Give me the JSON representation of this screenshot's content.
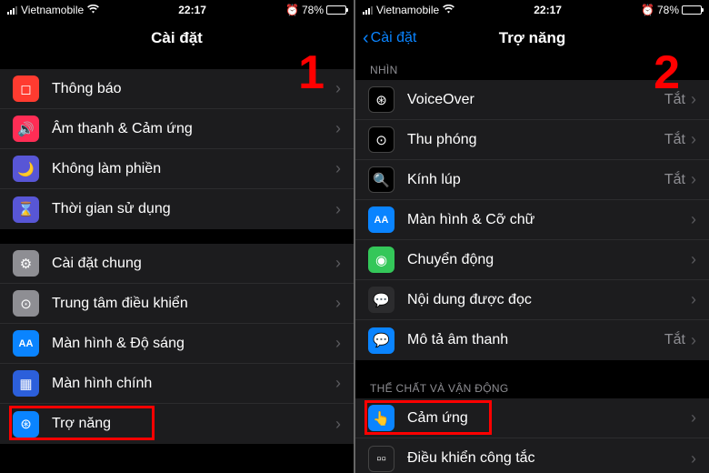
{
  "status": {
    "carrier": "Vietnamobile",
    "time": "22:17",
    "battery_pct": "78%",
    "alarm": "⏰"
  },
  "left": {
    "title": "Cài đặt",
    "step_number": "1",
    "groups": [
      {
        "rows": [
          {
            "icon": "notif",
            "glyph": "◻︎",
            "label": "Thông báo"
          },
          {
            "icon": "sound",
            "glyph": "🔊",
            "label": "Âm thanh & Cảm ứng"
          },
          {
            "icon": "dnd",
            "glyph": "🌙",
            "label": "Không làm phiền"
          },
          {
            "icon": "screentime",
            "glyph": "⌛",
            "label": "Thời gian sử dụng"
          }
        ]
      },
      {
        "rows": [
          {
            "icon": "general",
            "glyph": "⚙",
            "label": "Cài đặt chung"
          },
          {
            "icon": "control",
            "glyph": "⊙",
            "label": "Trung tâm điều khiển"
          },
          {
            "icon": "display",
            "glyph": "AA",
            "label": "Màn hình & Độ sáng"
          },
          {
            "icon": "home",
            "glyph": "▦",
            "label": "Màn hình chính"
          },
          {
            "icon": "access",
            "glyph": "⊛",
            "label": "Trợ năng",
            "highlight": true
          }
        ]
      }
    ]
  },
  "right": {
    "back": "Cài đặt",
    "title": "Trợ năng",
    "step_number": "2",
    "sections": [
      {
        "header": "NHÌN",
        "rows": [
          {
            "icon": "voiceover",
            "glyph": "⊛",
            "label": "VoiceOver",
            "value": "Tắt"
          },
          {
            "icon": "zoom",
            "glyph": "⊙",
            "label": "Thu phóng",
            "value": "Tắt"
          },
          {
            "icon": "magnify",
            "glyph": "🔍",
            "label": "Kính lúp",
            "value": "Tắt"
          },
          {
            "icon": "textsize",
            "glyph": "AA",
            "label": "Màn hình & Cỡ chữ"
          },
          {
            "icon": "motion",
            "glyph": "◉",
            "label": "Chuyển động"
          },
          {
            "icon": "spoken",
            "glyph": "💬",
            "label": "Nội dung được đọc"
          },
          {
            "icon": "audio",
            "glyph": "💬",
            "label": "Mô tả âm thanh",
            "value": "Tắt"
          }
        ]
      },
      {
        "header": "THỂ CHẤT VÀ VẬN ĐỘNG",
        "rows": [
          {
            "icon": "touch",
            "glyph": "👆",
            "label": "Cảm ứng",
            "highlight": true
          },
          {
            "icon": "switch",
            "glyph": "▫▫",
            "label": "Điều khiển công tắc"
          }
        ]
      }
    ]
  }
}
